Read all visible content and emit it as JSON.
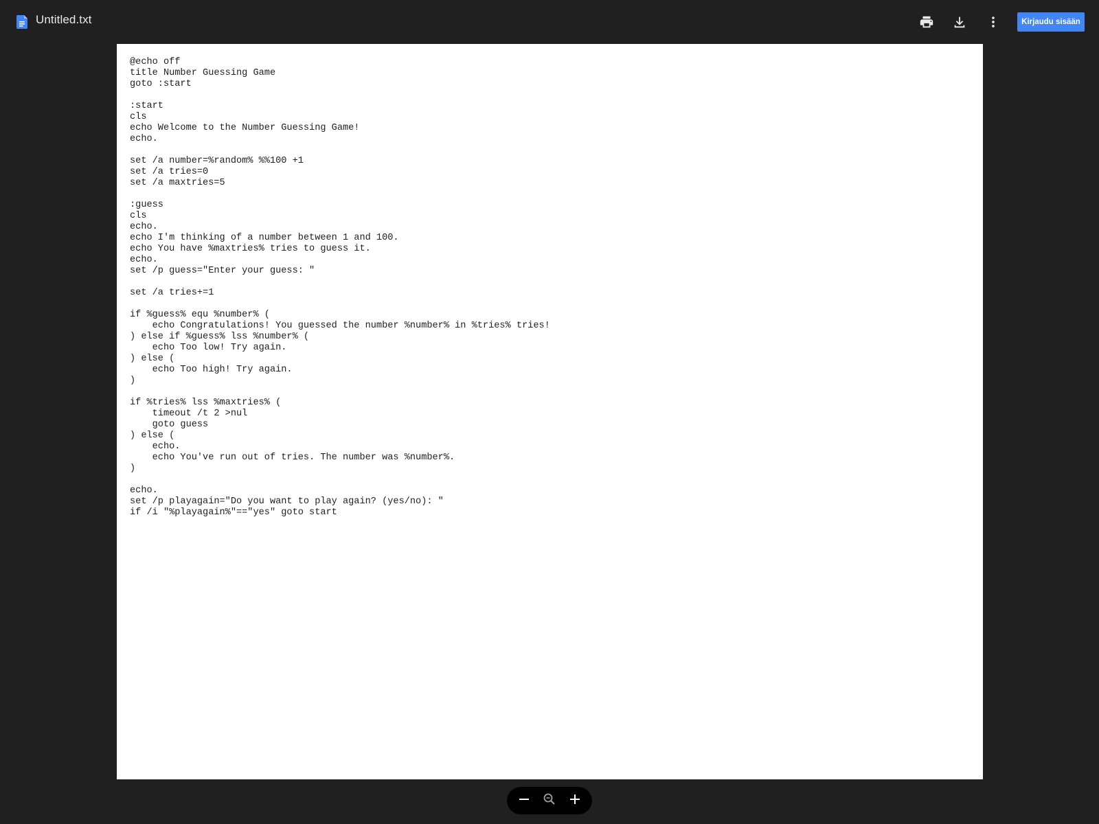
{
  "header": {
    "file_name": "Untitled.txt",
    "signin_label": "Kirjaudu sisään",
    "icons": [
      "docs-file-icon",
      "print-icon",
      "download-icon",
      "more-vert-icon"
    ]
  },
  "document": {
    "lines": [
      "@echo off",
      "title Number Guessing Game",
      "goto :start",
      "",
      ":start",
      "cls",
      "echo Welcome to the Number Guessing Game!",
      "echo.",
      "",
      "set /a number=%random% %%100 +1",
      "set /a tries=0",
      "set /a maxtries=5",
      "",
      ":guess",
      "cls",
      "echo.",
      "echo I'm thinking of a number between 1 and 100.",
      "echo You have %maxtries% tries to guess it.",
      "echo.",
      "set /p guess=\"Enter your guess: \"",
      "",
      "set /a tries+=1",
      "",
      "if %guess% equ %number% (",
      "    echo Congratulations! You guessed the number %number% in %tries% tries!",
      ") else if %guess% lss %number% (",
      "    echo Too low! Try again.",
      ") else (",
      "    echo Too high! Try again.",
      ")",
      "",
      "if %tries% lss %maxtries% (",
      "    timeout /t 2 >nul",
      "    goto guess",
      ") else (",
      "    echo.",
      "    echo You've run out of tries. The number was %number%.",
      ")",
      "",
      "echo.",
      "set /p playagain=\"Do you want to play again? (yes/no): \"",
      "if /i \"%playagain%\"==\"yes\" goto start"
    ]
  },
  "zoom_controls": {
    "icons": [
      "zoom-out-minus-icon",
      "zoom-reset-icon",
      "zoom-in-plus-icon"
    ]
  },
  "colors": {
    "background": "#202020",
    "accent": "#4285f4",
    "docs_icon": "#4285f4"
  }
}
